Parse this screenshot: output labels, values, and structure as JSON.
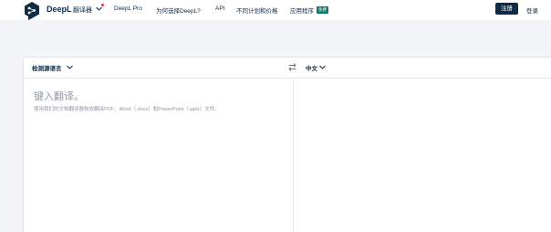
{
  "header": {
    "brand": "DeepL",
    "product": "翻译器",
    "nav": {
      "deepl_pro": "DeepL Pro",
      "why": "为何选择DeepL?",
      "api": "API",
      "plans": "不同计划和价格",
      "apps": "应用程序",
      "apps_badge": "免费"
    },
    "signup": "注册",
    "login": "登录"
  },
  "translator": {
    "source_lang": "检测源语言",
    "target_lang": "中文",
    "source_placeholder": "键入翻译。",
    "source_hint": "使用我们的文档翻译器拖放翻译PDF、Word（.docx）和PowerPoint（.pptx）文件。"
  },
  "colors": {
    "navy": "#0f2b46",
    "accent_red": "#e0323a",
    "badge_green": "#0a7a6b",
    "background": "#f3f4f7"
  },
  "icons": {
    "logo": "deepl-logo",
    "product_menu": "chevron-down-icon",
    "swap": "swap-icon"
  }
}
